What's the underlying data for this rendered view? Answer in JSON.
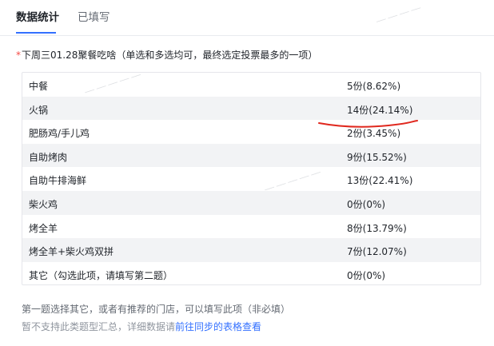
{
  "tabs": [
    {
      "label": "数据统计"
    },
    {
      "label": "已填写"
    }
  ],
  "question": {
    "required_mark": "*",
    "text": "下周三01.28聚餐吃啥（单选和多选均可，最终选定投票最多的一项）"
  },
  "options": [
    {
      "label": "中餐",
      "count": "5份(8.62%)"
    },
    {
      "label": "火锅",
      "count": "14份(24.14%)"
    },
    {
      "label": "肥肠鸡/手儿鸡",
      "count": "2份(3.45%)"
    },
    {
      "label": "自助烤肉",
      "count": "9份(15.52%)"
    },
    {
      "label": "自助牛排海鲜",
      "count": "13份(22.41%)"
    },
    {
      "label": "柴火鸡",
      "count": "0份(0%)"
    },
    {
      "label": "烤全羊",
      "count": "8份(13.79%)"
    },
    {
      "label": "烤全羊+柴火鸡双拼",
      "count": "7份(12.07%)"
    },
    {
      "label": "其它（勾选此项，请填写第二题）",
      "count": "0份(0%)"
    }
  ],
  "footer": {
    "note": "第一题选择其它，或者有推荐的门店，可以填写此项（非必填）",
    "unsupported": "暂不支持此类题型汇总，详细数据请",
    "link": "前往同步的表格查看"
  },
  "colors": {
    "accent": "#3370ff",
    "annotation": "#e0281e",
    "required": "#f54a45"
  }
}
